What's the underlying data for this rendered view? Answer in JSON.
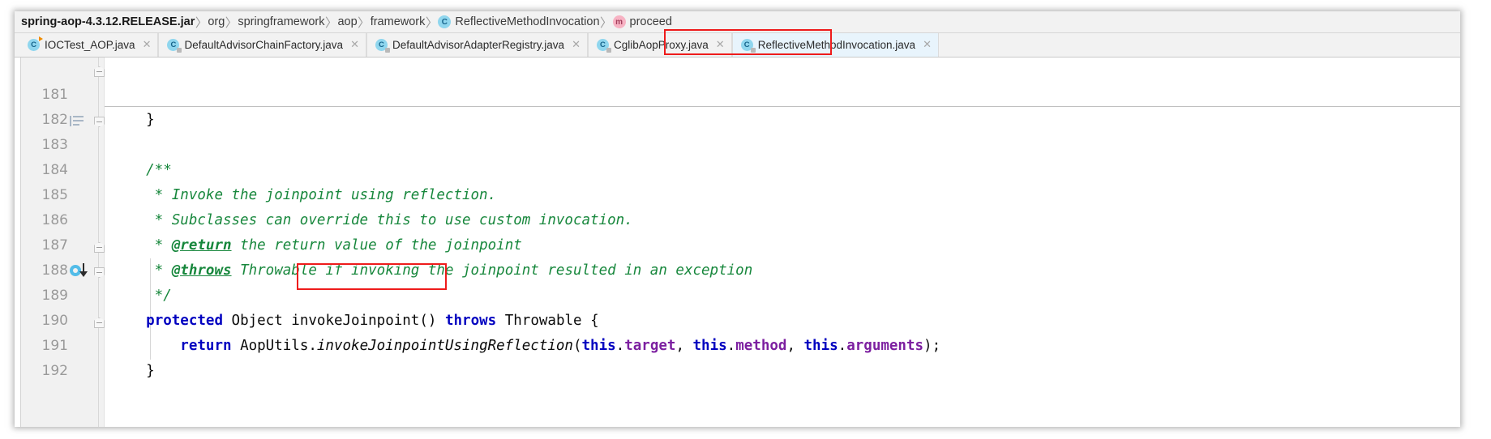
{
  "breadcrumb": {
    "items": [
      {
        "label": "spring-aop-4.3.12.RELEASE.jar",
        "icon": "",
        "bold": true
      },
      {
        "label": "org",
        "icon": ""
      },
      {
        "label": "springframework",
        "icon": ""
      },
      {
        "label": "aop",
        "icon": ""
      },
      {
        "label": "framework",
        "icon": ""
      },
      {
        "label": "ReflectiveMethodInvocation",
        "icon": "class-icon",
        "icon_letter": "C"
      },
      {
        "label": "proceed",
        "icon": "method-icon",
        "icon_letter": "m"
      }
    ],
    "separator": "〉"
  },
  "tabs": [
    {
      "label": "IOCTest_AOP.java",
      "icon": "java-class-icon",
      "icon_letter": "C",
      "close": "✕",
      "active": false,
      "badge": "run"
    },
    {
      "label": "DefaultAdvisorChainFactory.java",
      "icon": "java-class-icon",
      "icon_letter": "C",
      "close": "✕",
      "active": false,
      "badge": "lock"
    },
    {
      "label": "DefaultAdvisorAdapterRegistry.java",
      "icon": "java-class-icon",
      "icon_letter": "C",
      "close": "✕",
      "active": false,
      "badge": "lock"
    },
    {
      "label": "CglibAopProxy.java",
      "icon": "java-class-icon",
      "icon_letter": "C",
      "close": "✕",
      "active": false,
      "badge": "lock"
    },
    {
      "label": "ReflectiveMethodInvocation.java",
      "icon": "java-class-icon",
      "icon_letter": "C",
      "close": "✕",
      "active": true,
      "badge": "lock"
    }
  ],
  "annotations": {
    "active_tab_highlight_color": "#ee1b1b",
    "method_name_highlight_color": "#ee1b1b",
    "highlighted_method_name": "invokeJoinpoint"
  },
  "editor": {
    "lines": [
      {
        "number": "181",
        "text": "    }"
      },
      {
        "number": "182",
        "text": ""
      },
      {
        "number": "183",
        "text": "    /**"
      },
      {
        "number": "184",
        "text": "     * Invoke the joinpoint using reflection."
      },
      {
        "number": "185",
        "text": "     * Subclasses can override this to use custom invocation."
      },
      {
        "number": "186",
        "text": "     * @return the return value of the joinpoint"
      },
      {
        "number": "187",
        "text": "     * @throws Throwable if invoking the joinpoint resulted in an exception"
      },
      {
        "number": "188",
        "text": "     */"
      },
      {
        "number": "189",
        "text": "    protected Object invokeJoinpoint() throws Throwable {"
      },
      {
        "number": "190",
        "text": "        return AopUtils.invokeJoinpointUsingReflection(this.target, this.method, this.arguments);"
      },
      {
        "number": "191",
        "text": "    }"
      },
      {
        "number": "192",
        "text": ""
      }
    ],
    "javadoc": {
      "line_184_text": "Invoke the joinpoint using reflection.",
      "line_185_text": "Subclasses can override this to use custom invocation.",
      "line_186_tag": "@return",
      "line_186_text": "the return value of the joinpoint",
      "line_187_tag": "@throws",
      "line_187_text": "Throwable if invoking the joinpoint resulted in an exception"
    },
    "signature": {
      "modifier": "protected",
      "return_type": "Object",
      "method_name": "invokeJoinpoint",
      "parens": "()",
      "throws_kw": "throws",
      "exception": "Throwable",
      "brace": "{"
    },
    "body": {
      "return_kw": "return",
      "class_ref": "AopUtils.",
      "static_method": "invokeJoinpointUsingReflection",
      "open_paren": "(",
      "this_1": "this",
      "dot1": ".",
      "field_1": "target",
      "comma1": ", ",
      "this_2": "this",
      "dot2": ".",
      "field_2": "method",
      "comma2": ", ",
      "this_3": "this",
      "dot3": ".",
      "field_3": "arguments",
      "close": ");"
    },
    "colors": {
      "keyword": "#0000c0",
      "field": "#7c1fa0",
      "javadoc": "#17873c",
      "linenumber": "#9a9a9a",
      "gutter_bg": "#f1f1f1",
      "active_tab_bg": "#e8f4fc"
    },
    "gutter": {
      "comment_icon_line": "183",
      "override_icon_line": "189",
      "fold_lines": [
        "181",
        "183",
        "188",
        "189",
        "191"
      ]
    }
  }
}
